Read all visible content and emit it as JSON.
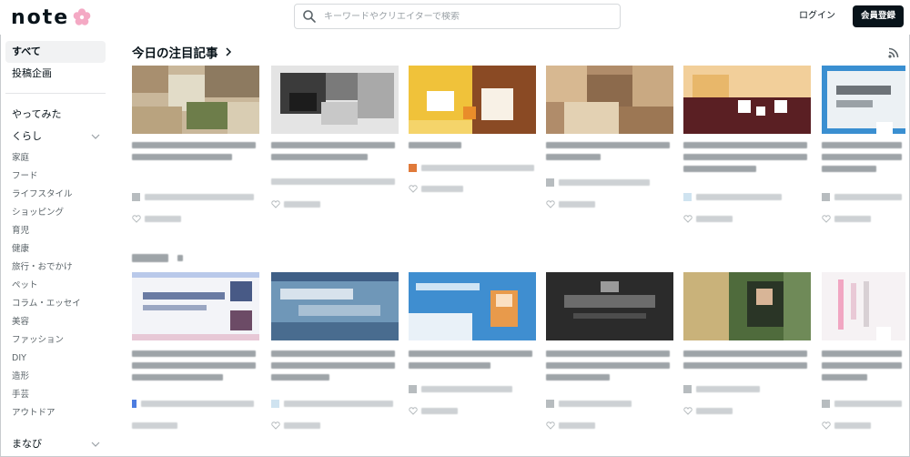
{
  "header": {
    "logo_text": "note",
    "search_placeholder": "キーワードやクリエイターで検索",
    "login_label": "ログイン",
    "signup_label": "会員登録"
  },
  "sidebar": {
    "top_items": [
      {
        "label": "すべて",
        "active": true
      },
      {
        "label": "投稿企画",
        "active": false
      }
    ],
    "groups": [
      {
        "label": "やってみた"
      },
      {
        "label": "くらし",
        "expandable": true
      },
      {
        "label": "まなび",
        "expandable": true
      }
    ],
    "subitems": [
      "家庭",
      "フード",
      "ライフスタイル",
      "ショッピング",
      "育児",
      "健康",
      "旅行・おでかけ",
      "ペット",
      "コラム・エッセイ",
      "美容",
      "ファッション",
      "DIY",
      "造形",
      "手芸",
      "アウトドア"
    ]
  },
  "main": {
    "section1_title": "今日の注目記事",
    "icons": [
      "chevron-right-icon",
      "rss-icon",
      "search-icon",
      "chevron-down-icon",
      "heart-icon"
    ],
    "colors": {
      "accent_dark": "#08131a",
      "logo_flower": "#f4a9c4",
      "text_muted": "#5a6368"
    }
  }
}
